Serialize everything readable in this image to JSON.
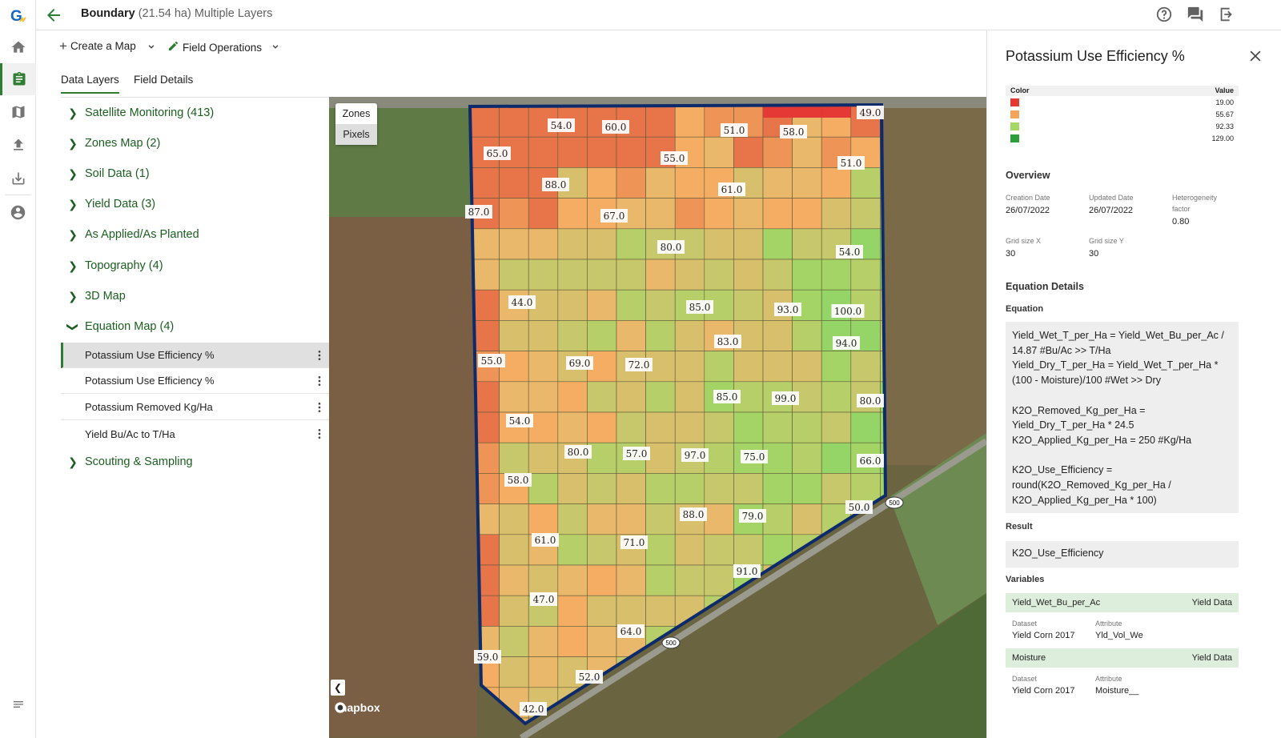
{
  "topbar": {
    "title_bold": "Boundary",
    "title_area": "(21.54 ha)",
    "title_suffix": "Multiple Layers"
  },
  "toolbar": {
    "create_map_label": "Create a Map",
    "field_operations_label": "Field Operations"
  },
  "tabs": [
    "Data Layers",
    "Field Details"
  ],
  "layer_groups": [
    {
      "label": "Satellite Monitoring (413)"
    },
    {
      "label": "Zones Map (2)"
    },
    {
      "label": "Soil Data (1)"
    },
    {
      "label": "Yield Data (3)"
    },
    {
      "label": "As Applied/As Planted"
    },
    {
      "label": "Topography (4)"
    },
    {
      "label": "3D Map"
    },
    {
      "label": "Equation Map (4)"
    },
    {
      "label": "Scouting & Sampling"
    }
  ],
  "equation_items": [
    "Potassium Use Efficiency %",
    "Potassium Use Efficiency %",
    "Potassium Removed Kg/Ha",
    "Yield Bu/Ac to T/Ha"
  ],
  "map": {
    "toggle": [
      "Zones",
      "Pixels"
    ],
    "attribution": "mapbox",
    "road_shield": "500",
    "cell_labels": [
      "54.0",
      "60.0",
      "51.0",
      "58.0",
      "49.0",
      "65.0",
      "55.0",
      "51.0",
      "88.0",
      "61.0",
      "87.0",
      "67.0",
      "80.0",
      "54.0",
      "44.0",
      "85.0",
      "93.0",
      "100.0",
      "83.0",
      "94.0",
      "55.0",
      "69.0",
      "72.0",
      "85.0",
      "99.0",
      "80.0",
      "54.0",
      "80.0",
      "57.0",
      "97.0",
      "75.0",
      "66.0",
      "58.0",
      "50.0",
      "88.0",
      "79.0",
      "61.0",
      "71.0",
      "91.0",
      "47.0",
      "64.0",
      "59.0",
      "52.0",
      "42.0"
    ]
  },
  "panel": {
    "title": "Potassium Use Efficiency %",
    "legend": {
      "color_header": "Color",
      "value_header": "Value",
      "rows": [
        {
          "color": "#e53935",
          "value": "19.00"
        },
        {
          "color": "#f5a45c",
          "value": "55.67"
        },
        {
          "color": "#a4d765",
          "value": "92.33"
        },
        {
          "color": "#2e9e3c",
          "value": "129.00"
        }
      ]
    },
    "overview": {
      "heading": "Overview",
      "creation_label": "Creation Date",
      "creation_value": "26/07/2022",
      "updated_label": "Updated Date",
      "updated_value": "26/07/2022",
      "hetero_label_1": "Heterogeneity",
      "hetero_label_2": "factor",
      "hetero_value": "0.80",
      "gridx_label": "Grid size X",
      "gridx_value": "30",
      "gridy_label": "Grid size Y",
      "gridy_value": "30"
    },
    "equation_details_heading": "Equation Details",
    "equation_label": "Equation",
    "equation_text": "Yield_Wet_T_per_Ha = Yield_Wet_Bu_per_Ac / 14.87 #Bu/Ac >> T/Ha\nYield_Dry_T_per_Ha = Yield_Wet_T_per_Ha * (100 - Moisture)/100 #Wet >> Dry\n\nK2O_Removed_Kg_per_Ha =\nYield_Dry_T_per_Ha * 24.5\nK2O_Applied_Kg_per_Ha = 250 #Kg/Ha\n\nK2O_Use_Efficiency =\nround(K2O_Removed_Kg_per_Ha /\nK2O_Applied_Kg_per_Ha * 100)",
    "result_label": "Result",
    "result_value": "K2O_Use_Efficiency",
    "variables_label": "Variables",
    "variables": [
      {
        "name": "Yield_Wet_Bu_per_Ac",
        "source": "Yield Data",
        "dataset_label": "Dataset",
        "dataset": "Yield Corn 2017",
        "attribute_label": "Attribute",
        "attribute": "Yld_Vol_We"
      },
      {
        "name": "Moisture",
        "source": "Yield Data",
        "dataset_label": "Dataset",
        "dataset": "Yield Corn 2017",
        "attribute_label": "Attribute",
        "attribute": "Moisture__"
      }
    ]
  }
}
